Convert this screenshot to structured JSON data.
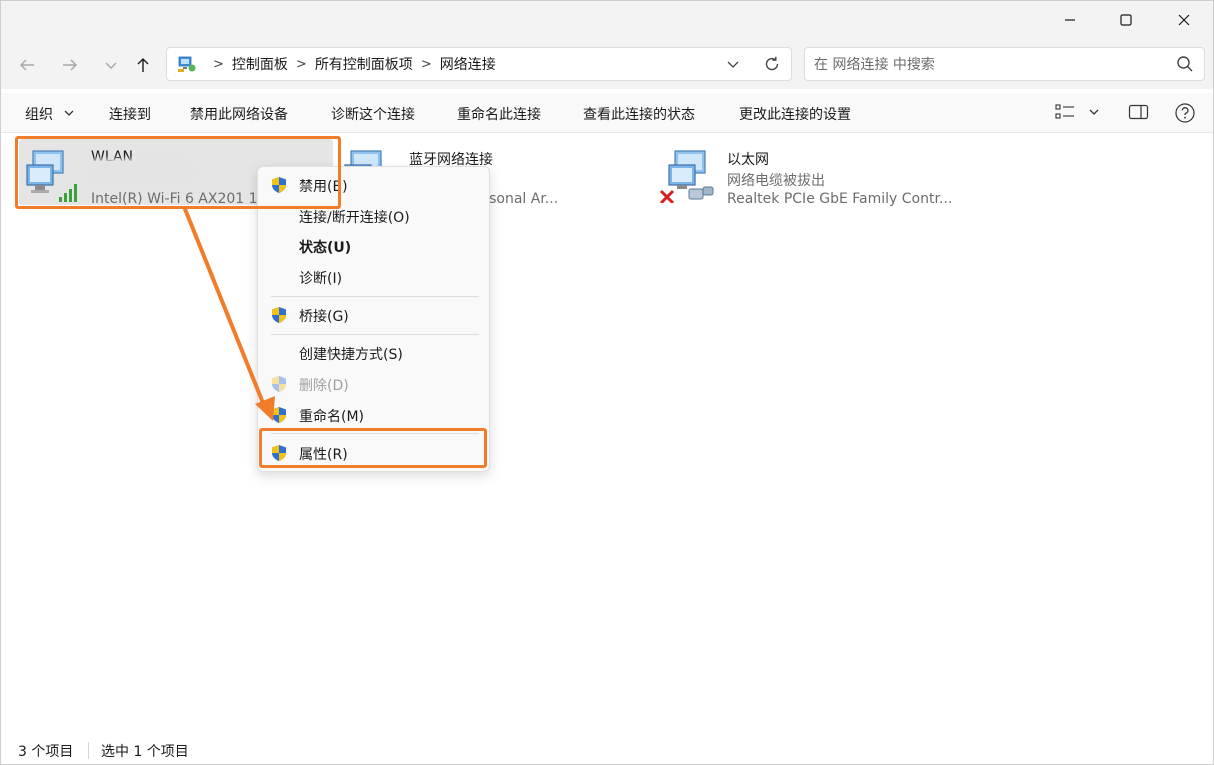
{
  "window": {
    "minimize_icon": "minimize-icon",
    "maximize_icon": "maximize-icon",
    "close_icon": "close-icon"
  },
  "nav": {
    "back_icon": "arrow-left-icon",
    "forward_icon": "arrow-right-icon",
    "recent_icon": "chevron-down-icon",
    "up_icon": "arrow-up-icon"
  },
  "address": {
    "crumbs": [
      "控制面板",
      "所有控制面板项",
      "网络连接"
    ],
    "separator": ">",
    "dropdown_icon": "chevron-down-icon",
    "refresh_icon": "refresh-icon"
  },
  "search": {
    "placeholder": "在 网络连接 中搜索",
    "icon": "search-icon"
  },
  "commands": {
    "organize": "组织",
    "connect_to": "连接到",
    "disable_device": "禁用此网络设备",
    "diagnose": "诊断这个连接",
    "rename": "重命名此连接",
    "view_status": "查看此连接的状态",
    "change_settings": "更改此连接的设置",
    "view_icon": "view-options-icon",
    "pane_icon": "preview-pane-icon",
    "help_icon": "help-icon"
  },
  "connections": [
    {
      "name": "WLAN",
      "status": "",
      "device": "Intel(R) Wi-Fi 6 AX201 1",
      "icon": "wifi-adapter-icon"
    },
    {
      "name": "蓝牙网络连接",
      "status": "",
      "device": "Device (Personal Ar...",
      "icon": "network-adapter-icon"
    },
    {
      "name": "以太网",
      "status": "网络电缆被拔出",
      "device": "Realtek PCIe GbE Family Contr...",
      "icon": "ethernet-adapter-icon"
    }
  ],
  "context_menu": {
    "items": [
      {
        "label": "禁用(B)",
        "shield": true
      },
      {
        "label": "连接/断开连接(O)",
        "shield": false
      },
      {
        "label": "状态(U)",
        "shield": false,
        "bold": true
      },
      {
        "label": "诊断(I)",
        "shield": false
      },
      {
        "label": "桥接(G)",
        "shield": true
      },
      {
        "label": "创建快捷方式(S)",
        "shield": false
      },
      {
        "label": "删除(D)",
        "shield": true,
        "disabled": true
      },
      {
        "label": "重命名(M)",
        "shield": true
      },
      {
        "label": "属性(R)",
        "shield": true
      }
    ]
  },
  "status_bar": {
    "count": "3 个项目",
    "selected": "选中 1 个项目"
  },
  "colors": {
    "highlight": "#f07d2a",
    "accent": "#0067c0"
  }
}
